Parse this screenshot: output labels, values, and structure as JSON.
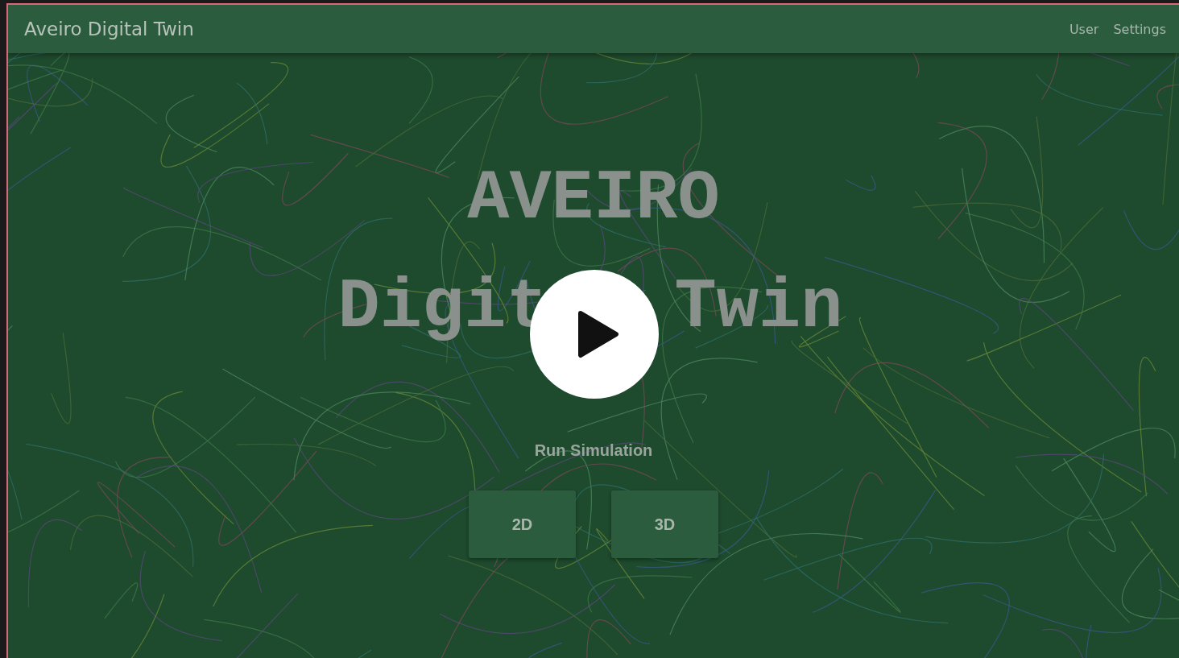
{
  "navbar": {
    "title": "Aveiro Digital Twin",
    "links": [
      "User",
      "Settings"
    ]
  },
  "hero": {
    "title_line_1": "AVEIRO",
    "title_line_2_left": "Digit",
    "title_line_2_right": "Twin"
  },
  "simulation": {
    "heading": "Run Simulation",
    "buttons": [
      "2D",
      "3D"
    ]
  }
}
